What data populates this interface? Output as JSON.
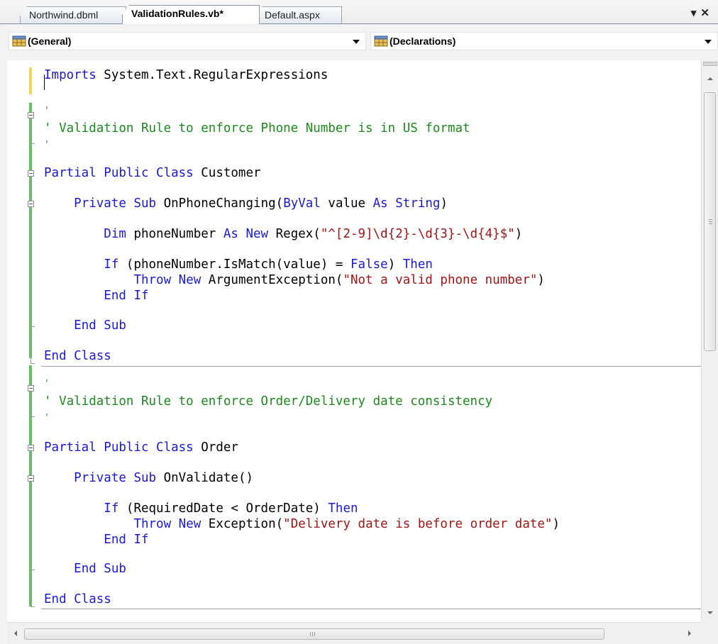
{
  "tabs": [
    {
      "label": "Northwind.dbml",
      "active": false
    },
    {
      "label": "ValidationRules.vb*",
      "active": true
    },
    {
      "label": "Default.aspx",
      "active": false
    }
  ],
  "tab_controls": {
    "dropdown_icon": "chevron-down-icon",
    "close_icon": "close-icon",
    "text": "▾ ✕"
  },
  "dropdowns": {
    "left": {
      "value": "(General)",
      "icon": "class-icon"
    },
    "right": {
      "value": "(Declarations)",
      "icon": "member-icon"
    }
  },
  "colors": {
    "keyword": "#1a1ad6",
    "comment": "#1b8c1b",
    "string": "#a31515",
    "text": "#000000",
    "changed_margin": "#f5d55a",
    "saved_margin": "#5fc35f"
  },
  "code": [
    [
      {
        "t": "kw",
        "v": "Imports"
      },
      {
        "t": "tx",
        "v": " System.Text.RegularExpressions"
      }
    ],
    [
      {
        "t": "cm",
        "v": "'"
      }
    ],
    [
      {
        "t": "cm",
        "v": "' Validation Rule to enforce Phone Number is in US format"
      }
    ],
    [
      {
        "t": "cm",
        "v": "'"
      }
    ],
    [
      {
        "t": "kw",
        "v": "Partial Public Class"
      },
      {
        "t": "tx",
        "v": " Customer"
      }
    ],
    [
      {
        "t": "tx",
        "v": "    "
      },
      {
        "t": "kw",
        "v": "Private Sub"
      },
      {
        "t": "tx",
        "v": " OnPhoneChanging("
      },
      {
        "t": "kw",
        "v": "ByVal"
      },
      {
        "t": "tx",
        "v": " value "
      },
      {
        "t": "kw",
        "v": "As String"
      },
      {
        "t": "tx",
        "v": ")"
      }
    ],
    [
      {
        "t": "tx",
        "v": "        "
      },
      {
        "t": "kw",
        "v": "Dim"
      },
      {
        "t": "tx",
        "v": " phoneNumber "
      },
      {
        "t": "kw",
        "v": "As New"
      },
      {
        "t": "tx",
        "v": " Regex("
      },
      {
        "t": "st",
        "v": "\"^[2-9]\\d{2}-\\d{3}-\\d{4}$\""
      },
      {
        "t": "tx",
        "v": ")"
      }
    ],
    [
      {
        "t": "tx",
        "v": "        "
      },
      {
        "t": "kw",
        "v": "If"
      },
      {
        "t": "tx",
        "v": " (phoneNumber.IsMatch(value) = "
      },
      {
        "t": "kw",
        "v": "False"
      },
      {
        "t": "tx",
        "v": ") "
      },
      {
        "t": "kw",
        "v": "Then"
      }
    ],
    [
      {
        "t": "tx",
        "v": "            "
      },
      {
        "t": "kw",
        "v": "Throw New"
      },
      {
        "t": "tx",
        "v": " ArgumentException("
      },
      {
        "t": "st",
        "v": "\"Not a valid phone number\""
      },
      {
        "t": "tx",
        "v": ")"
      }
    ],
    [
      {
        "t": "tx",
        "v": "        "
      },
      {
        "t": "kw",
        "v": "End If"
      }
    ],
    [
      {
        "t": "tx",
        "v": "    "
      },
      {
        "t": "kw",
        "v": "End Sub"
      }
    ],
    [
      {
        "t": "kw",
        "v": "End Class"
      }
    ],
    [
      {
        "t": "cm",
        "v": "'"
      }
    ],
    [
      {
        "t": "cm",
        "v": "' Validation Rule to enforce Order/Delivery date consistency"
      }
    ],
    [
      {
        "t": "cm",
        "v": "'"
      }
    ],
    [
      {
        "t": "kw",
        "v": "Partial Public Class"
      },
      {
        "t": "tx",
        "v": " Order"
      }
    ],
    [
      {
        "t": "tx",
        "v": "    "
      },
      {
        "t": "kw",
        "v": "Private Sub"
      },
      {
        "t": "tx",
        "v": " OnValidate()"
      }
    ],
    [
      {
        "t": "tx",
        "v": "        "
      },
      {
        "t": "kw",
        "v": "If"
      },
      {
        "t": "tx",
        "v": " (RequiredDate < OrderDate) "
      },
      {
        "t": "kw",
        "v": "Then"
      }
    ],
    [
      {
        "t": "tx",
        "v": "            "
      },
      {
        "t": "kw",
        "v": "Throw New"
      },
      {
        "t": "tx",
        "v": " Exception("
      },
      {
        "t": "st",
        "v": "\"Delivery date is before order date\""
      },
      {
        "t": "tx",
        "v": ")"
      }
    ],
    [
      {
        "t": "tx",
        "v": "        "
      },
      {
        "t": "kw",
        "v": "End If"
      }
    ],
    [
      {
        "t": "tx",
        "v": "    "
      },
      {
        "t": "kw",
        "v": "End Sub"
      }
    ],
    [
      {
        "t": "kw",
        "v": "End Class"
      }
    ]
  ],
  "scrollbars": {
    "horizontal_grip": "III",
    "vertical_grip": "≡"
  }
}
